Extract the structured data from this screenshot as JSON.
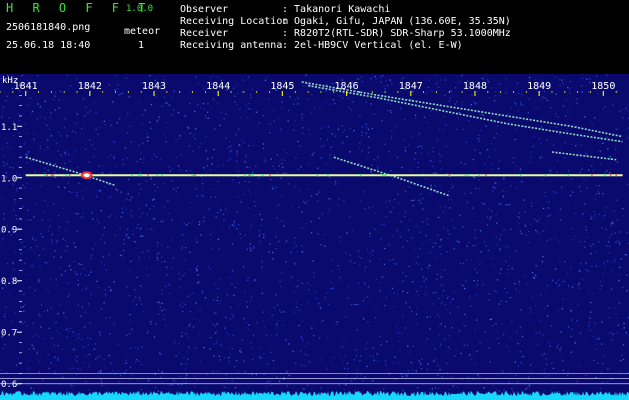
{
  "header": {
    "app_name": "H R O F F T",
    "app_version": "1.0.0",
    "file_name": "2506181840.png",
    "date_time": "25.06.18 18:40",
    "meteor_label": "meteor",
    "meteor_count": "1",
    "info": [
      {
        "key": "Observer",
        "value": ": Takanori Kawachi"
      },
      {
        "key": "Receiving Location",
        "value": ": Ogaki, Gifu, JAPAN (136.60E, 35.35N)"
      },
      {
        "key": "Receiver",
        "value": ": R820T2(RTL-SDR) SDR-Sharp 53.1000MHz"
      },
      {
        "key": "Receiving antenna",
        "value": ": 2el-HB9CV Vertical (el. E-W)"
      }
    ]
  },
  "colors": {
    "header_green": "#39e63a",
    "tick_yellow": "#e8e800",
    "background_blue": "#0a0a6e",
    "noise_floor": "#19d8ff",
    "carrier": "#e8ff9a"
  },
  "chart_data": {
    "type": "heatmap",
    "title": "",
    "ylabel": "kHz",
    "xlabel": "",
    "x_ticks": [
      "1841",
      "1842",
      "1843",
      "1844",
      "1845",
      "1846",
      "1847",
      "1848",
      "1849",
      "1850"
    ],
    "x_range": [
      1840.6,
      1850.4
    ],
    "y_ticks": [
      1.1,
      1.0,
      0.9,
      0.8,
      0.7,
      0.6
    ],
    "y_range": [
      0.58,
      1.186
    ],
    "grid": false,
    "carrier": {
      "freq_khz": 1.005,
      "x_start": 1841.0,
      "x_end": 1850.3
    },
    "meteor_echo": {
      "x": 1841.95,
      "freq_khz": 1.005
    },
    "traces": [
      {
        "x": [
          1845.3,
          1846.5,
          1847.5,
          1848.5,
          1849.5,
          1850.3
        ],
        "freq_khz": [
          1.186,
          1.16,
          1.14,
          1.12,
          1.1,
          1.08
        ]
      },
      {
        "x": [
          1845.4,
          1846.5,
          1847.5,
          1848.5,
          1849.5,
          1850.3
        ],
        "freq_khz": [
          1.179,
          1.155,
          1.13,
          1.105,
          1.085,
          1.07
        ]
      },
      {
        "x": [
          1841.0,
          1841.8,
          1842.4
        ],
        "freq_khz": [
          1.04,
          1.01,
          0.985
        ]
      },
      {
        "x": [
          1845.8,
          1846.8,
          1847.6
        ],
        "freq_khz": [
          1.04,
          1.0,
          0.965
        ]
      },
      {
        "x": [
          1849.2,
          1850.2
        ],
        "freq_khz": [
          1.05,
          1.035
        ]
      }
    ],
    "reference_lines_khz": [
      0.62,
      0.61,
      0.6
    ]
  }
}
